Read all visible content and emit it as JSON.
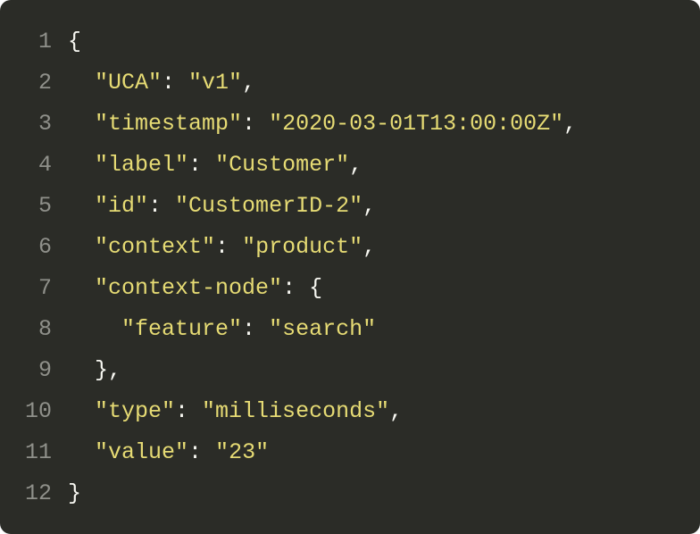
{
  "code": {
    "language": "json",
    "lines": [
      {
        "num": "1",
        "tokens": [
          {
            "t": "{",
            "c": "pn"
          }
        ]
      },
      {
        "num": "2",
        "tokens": [
          {
            "t": "  ",
            "c": "pn"
          },
          {
            "t": "\"UCA\"",
            "c": "key"
          },
          {
            "t": ": ",
            "c": "colon"
          },
          {
            "t": "\"v1\"",
            "c": "str"
          },
          {
            "t": ",",
            "c": "pn"
          }
        ]
      },
      {
        "num": "3",
        "tokens": [
          {
            "t": "  ",
            "c": "pn"
          },
          {
            "t": "\"timestamp\"",
            "c": "key"
          },
          {
            "t": ": ",
            "c": "colon"
          },
          {
            "t": "\"2020-03-01T13:00:00Z\"",
            "c": "str"
          },
          {
            "t": ",",
            "c": "pn"
          }
        ]
      },
      {
        "num": "4",
        "tokens": [
          {
            "t": "  ",
            "c": "pn"
          },
          {
            "t": "\"label\"",
            "c": "key"
          },
          {
            "t": ": ",
            "c": "colon"
          },
          {
            "t": "\"Customer\"",
            "c": "str"
          },
          {
            "t": ",",
            "c": "pn"
          }
        ]
      },
      {
        "num": "5",
        "tokens": [
          {
            "t": "  ",
            "c": "pn"
          },
          {
            "t": "\"id\"",
            "c": "key"
          },
          {
            "t": ": ",
            "c": "colon"
          },
          {
            "t": "\"CustomerID-2\"",
            "c": "str"
          },
          {
            "t": ",",
            "c": "pn"
          }
        ]
      },
      {
        "num": "6",
        "tokens": [
          {
            "t": "  ",
            "c": "pn"
          },
          {
            "t": "\"context\"",
            "c": "key"
          },
          {
            "t": ": ",
            "c": "colon"
          },
          {
            "t": "\"product\"",
            "c": "str"
          },
          {
            "t": ",",
            "c": "pn"
          }
        ]
      },
      {
        "num": "7",
        "tokens": [
          {
            "t": "  ",
            "c": "pn"
          },
          {
            "t": "\"context-node\"",
            "c": "key"
          },
          {
            "t": ": ",
            "c": "colon"
          },
          {
            "t": "{",
            "c": "pn"
          }
        ]
      },
      {
        "num": "8",
        "tokens": [
          {
            "t": "    ",
            "c": "pn"
          },
          {
            "t": "\"feature\"",
            "c": "key"
          },
          {
            "t": ": ",
            "c": "colon"
          },
          {
            "t": "\"search\"",
            "c": "str"
          }
        ]
      },
      {
        "num": "9",
        "tokens": [
          {
            "t": "  ",
            "c": "pn"
          },
          {
            "t": "},",
            "c": "pn"
          }
        ]
      },
      {
        "num": "10",
        "tokens": [
          {
            "t": "  ",
            "c": "pn"
          },
          {
            "t": "\"type\"",
            "c": "key"
          },
          {
            "t": ": ",
            "c": "colon"
          },
          {
            "t": "\"milliseconds\"",
            "c": "str"
          },
          {
            "t": ",",
            "c": "pn"
          }
        ]
      },
      {
        "num": "11",
        "tokens": [
          {
            "t": "  ",
            "c": "pn"
          },
          {
            "t": "\"value\"",
            "c": "key"
          },
          {
            "t": ": ",
            "c": "colon"
          },
          {
            "t": "\"23\"",
            "c": "str"
          }
        ]
      },
      {
        "num": "12",
        "tokens": [
          {
            "t": "}",
            "c": "pn"
          }
        ]
      }
    ]
  }
}
